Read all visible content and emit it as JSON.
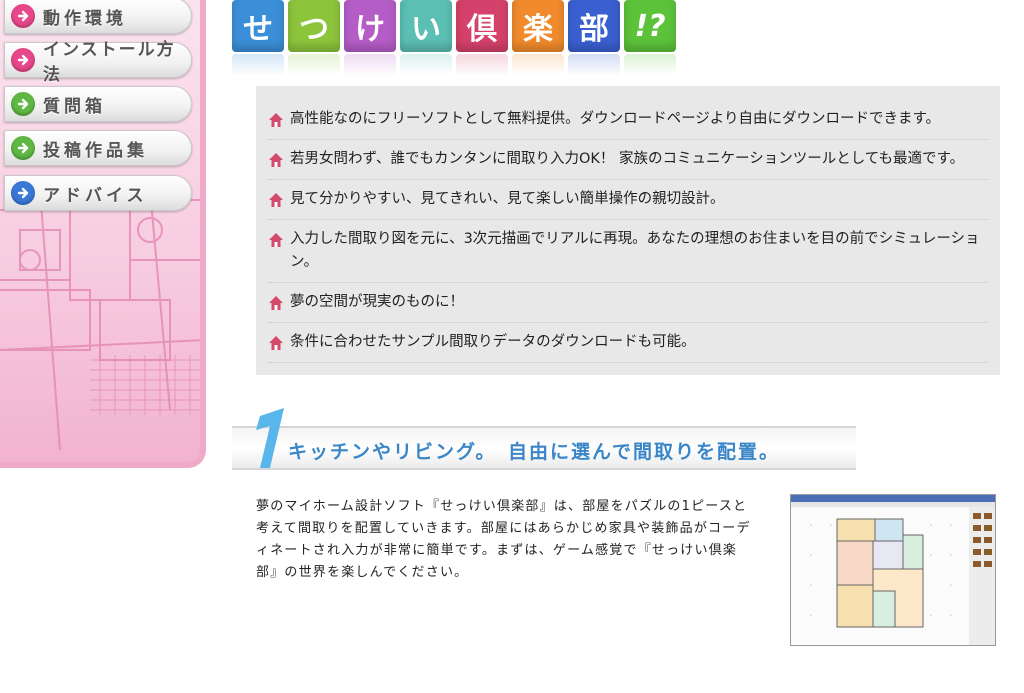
{
  "sidebar": {
    "items": [
      {
        "label": "動作環境",
        "icon_color": "#e8478b",
        "icon": "arrow-right-icon"
      },
      {
        "label": "インストール方法",
        "icon_color": "#e8478b",
        "icon": "arrow-right-icon"
      },
      {
        "label": "質問箱",
        "icon_color": "#5fb844",
        "icon": "arrow-right-icon"
      },
      {
        "label": "投稿作品集",
        "icon_color": "#5fb844",
        "icon": "arrow-right-icon"
      },
      {
        "label": "アドバイス",
        "icon_color": "#3a78d8",
        "icon": "arrow-right-icon"
      }
    ]
  },
  "logo": {
    "tiles": [
      {
        "char": "せ",
        "color": "#3a8fd8"
      },
      {
        "char": "つ",
        "color": "#8cc43c"
      },
      {
        "char": "け",
        "color": "#b55dc7"
      },
      {
        "char": "い",
        "color": "#5bbfb3"
      },
      {
        "char": "倶",
        "color": "#d4416a"
      },
      {
        "char": "楽",
        "color": "#f08a2c"
      },
      {
        "char": "部",
        "color": "#3a5fd0"
      },
      {
        "char": "!?",
        "color": "#5cc23a"
      }
    ]
  },
  "features": {
    "bullet_icon": "house-icon",
    "bullet_color": "#d34a6a",
    "items": [
      "高性能なのにフリーソフトとして無料提供。ダウンロードページより自由にダウンロードできます。",
      "若男女問わず、誰でもカンタンに間取り入力OK！ 家族のコミュニケーションツールとしても最適です。",
      "見て分かりやすい、見てきれい、見て楽しい簡単操作の親切設計。",
      "入力した間取り図を元に、3次元描画でリアルに再現。あなたの理想のお住まいを目の前でシミュレーション。",
      "夢の空間が現実のものに！",
      "条件に合わせたサンプル間取りデータのダウンロードも可能。"
    ]
  },
  "section": {
    "number": "1",
    "title": "キッチンやリビング。　自由に選んで間取りを配置。",
    "accent": "#3b86c8"
  },
  "description": "夢のマイホーム設計ソフト『せっけい倶楽部』は、部屋をパズルの1ピースと考えて間取りを配置していきます。部屋にはあらかじめ家具や装飾品がコーディネートされ入力が非常に簡単です。まずは、ゲーム感覚で『せっけい倶楽部』の世界を楽しんでください。"
}
